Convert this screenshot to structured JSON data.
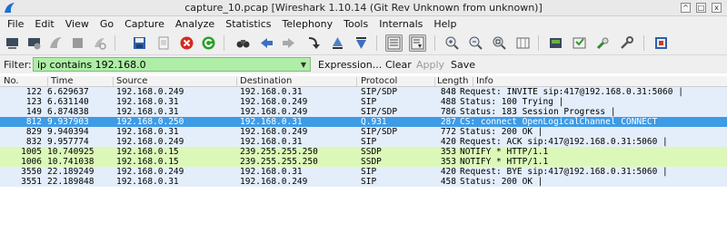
{
  "window": {
    "title": "capture_10.pcap   [Wireshark 1.10.14  (Git Rev Unknown from unknown)]",
    "controls": [
      "^",
      "□",
      "x"
    ]
  },
  "menu": [
    "File",
    "Edit",
    "View",
    "Go",
    "Capture",
    "Analyze",
    "Statistics",
    "Telephony",
    "Tools",
    "Internals",
    "Help"
  ],
  "toolbar": {
    "icons": [
      "interfaces-icon",
      "options-icon",
      "start-capture-icon",
      "stop-capture-icon",
      "restart-capture-icon",
      "open-file-icon",
      "save-file-icon",
      "close-file-icon",
      "reload-icon",
      "find-packet-icon",
      "go-back-icon",
      "go-forward-icon",
      "go-to-packet-icon",
      "go-first-icon",
      "go-last-icon",
      "colorize-icon",
      "auto-scroll-icon",
      "zoom-in-icon",
      "zoom-out-icon",
      "normal-size-icon",
      "resize-columns-icon",
      "capture-filters-icon",
      "display-filters-icon",
      "coloring-rules-icon",
      "preferences-icon",
      "help-icon"
    ]
  },
  "filter": {
    "label": "Filter:",
    "value": "ip contains 192.168.0",
    "expression_label": "Expression...",
    "clear_label": "Clear",
    "apply_label": "Apply",
    "save_label": "Save"
  },
  "packets": {
    "columns": [
      "No.",
      "Time",
      "Source",
      "Destination",
      "Protocol",
      "Length",
      "Info"
    ],
    "rows": [
      {
        "no": "122",
        "time": "6.629637",
        "src": "192.168.0.249",
        "dst": "192.168.0.31",
        "proto": "SIP/SDP",
        "len": "848",
        "info": "Request: INVITE sip:417@192.168.0.31:5060 |",
        "bg": "#e4eefb",
        "fg": "#000000"
      },
      {
        "no": "123",
        "time": "6.631140",
        "src": "192.168.0.31",
        "dst": "192.168.0.249",
        "proto": "SIP",
        "len": "488",
        "info": "Status: 100 Trying |",
        "bg": "#e4eefb",
        "fg": "#000000"
      },
      {
        "no": "149",
        "time": "6.874838",
        "src": "192.168.0.31",
        "dst": "192.168.0.249",
        "proto": "SIP/SDP",
        "len": "786",
        "info": "Status: 183 Session Progress |",
        "bg": "#e4eefb",
        "fg": "#000000"
      },
      {
        "no": "812",
        "time": "9.937903",
        "src": "192.168.0.250",
        "dst": "192.168.0.31",
        "proto": "Q.931",
        "len": "287",
        "info": "CS: connect OpenLogicalChannel CONNECT",
        "bg": "#3e9be6",
        "fg": "#ffffff"
      },
      {
        "no": "829",
        "time": "9.940394",
        "src": "192.168.0.31",
        "dst": "192.168.0.249",
        "proto": "SIP/SDP",
        "len": "772",
        "info": "Status: 200 OK |",
        "bg": "#e4eefb",
        "fg": "#000000"
      },
      {
        "no": "832",
        "time": "9.957774",
        "src": "192.168.0.249",
        "dst": "192.168.0.31",
        "proto": "SIP",
        "len": "420",
        "info": "Request: ACK sip:417@192.168.0.31:5060 |",
        "bg": "#e4eefb",
        "fg": "#000000"
      },
      {
        "no": "1005",
        "time": "10.740925",
        "src": "192.168.0.15",
        "dst": "239.255.255.250",
        "proto": "SSDP",
        "len": "353",
        "info": "NOTIFY * HTTP/1.1",
        "bg": "#dcf8b8",
        "fg": "#000000"
      },
      {
        "no": "1006",
        "time": "10.741038",
        "src": "192.168.0.15",
        "dst": "239.255.255.250",
        "proto": "SSDP",
        "len": "353",
        "info": "NOTIFY * HTTP/1.1",
        "bg": "#dcf8b8",
        "fg": "#000000"
      },
      {
        "no": "3550",
        "time": "22.189249",
        "src": "192.168.0.249",
        "dst": "192.168.0.31",
        "proto": "SIP",
        "len": "420",
        "info": "Request: BYE sip:417@192.168.0.31:5060 |",
        "bg": "#e4eefb",
        "fg": "#000000"
      },
      {
        "no": "3551",
        "time": "22.189848",
        "src": "192.168.0.31",
        "dst": "192.168.0.249",
        "proto": "SIP",
        "len": "458",
        "info": "Status: 200 OK |",
        "bg": "#e4eefb",
        "fg": "#000000"
      }
    ]
  }
}
